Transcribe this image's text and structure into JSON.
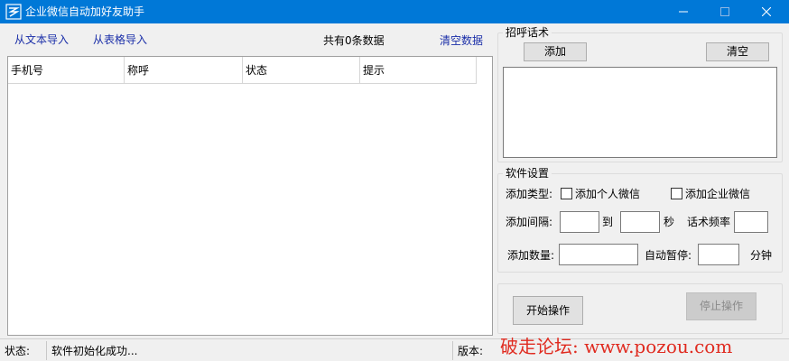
{
  "window": {
    "title": "企业微信自动加好友助手",
    "controls": {
      "minimize": "—",
      "maximize": "□",
      "close": "✕"
    }
  },
  "toolbar": {
    "import_text": "从文本导入",
    "import_table": "从表格导入",
    "count": "共有0条数据",
    "clear_data": "清空数据"
  },
  "table": {
    "columns": [
      "手机号",
      "称呼",
      "状态",
      "提示"
    ],
    "rows": []
  },
  "greeting": {
    "title": "招呼话术",
    "add": "添加",
    "clear": "清空"
  },
  "settings": {
    "title": "软件设置",
    "type_label": "添加类型:",
    "personal_wechat": "添加个人微信",
    "enterprise_wechat": "添加企业微信",
    "interval_label": "添加间隔:",
    "to": "到",
    "seconds": "秒",
    "freq_label": "话术频率",
    "quantity_label": "添加数量:",
    "auto_pause_label": "自动暂停:",
    "minutes": "分钟",
    "interval_from": "",
    "interval_to": "",
    "freq": "",
    "quantity": "",
    "auto_pause": ""
  },
  "actions": {
    "start": "开始操作",
    "stop": "停止操作"
  },
  "statusbar": {
    "status_label": "状态:",
    "status_text": "软件初始化成功...",
    "version_label": "版本:",
    "watermark": "破走论坛: www.pozou.com"
  },
  "colors": {
    "titlebar": "#0078d7",
    "link": "#1a2ea8",
    "watermark": "#e02b20"
  }
}
